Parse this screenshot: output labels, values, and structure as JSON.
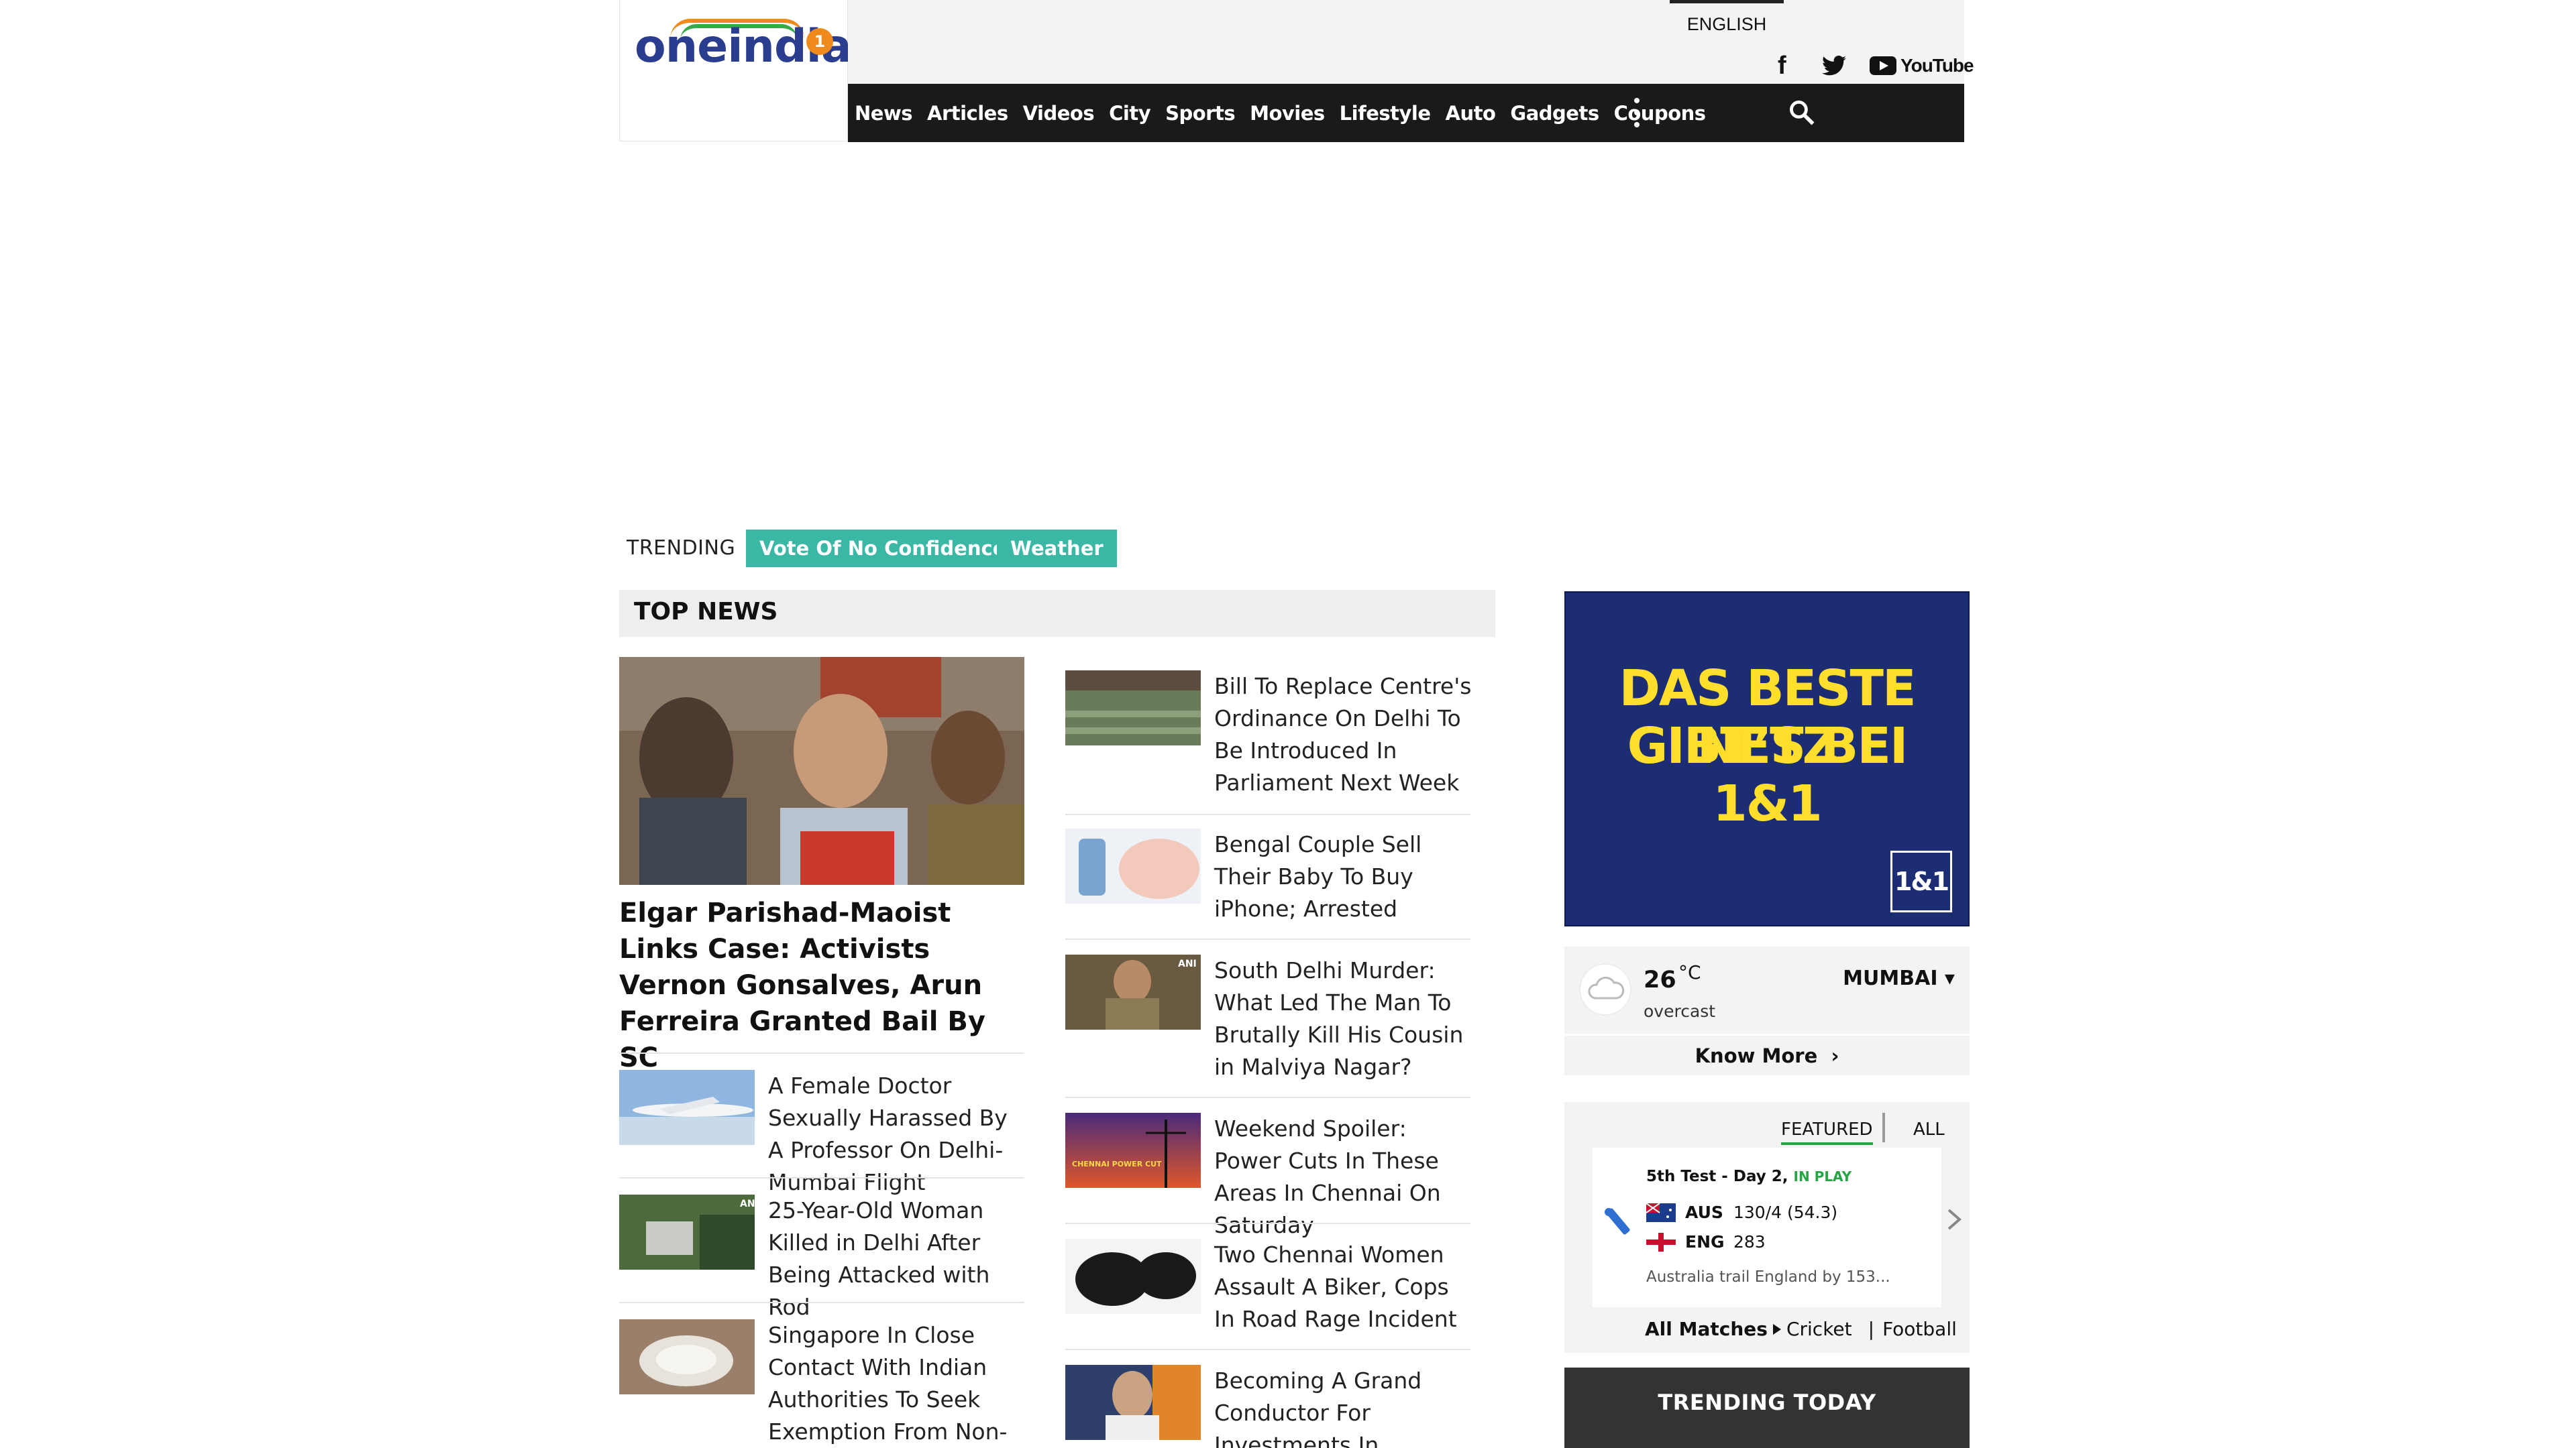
{
  "brand": {
    "logo_text_one": "one",
    "logo_text_india": "india",
    "logo_badge": "1",
    "primary_color": "#2b3d8f",
    "accent_color": "#f08a1c"
  },
  "header": {
    "language": "ENGLISH",
    "social": {
      "facebook_icon": "facebook-icon",
      "twitter_icon": "twitter-icon",
      "youtube_label": "YouTube"
    },
    "nav": [
      "News",
      "Articles",
      "Videos",
      "City",
      "Sports",
      "Movies",
      "Lifestyle",
      "Auto",
      "Gadgets",
      "Coupons"
    ],
    "more_icon": "more-vertical-icon",
    "search_icon": "search-icon"
  },
  "trending": {
    "label": "TRENDING",
    "chips": [
      "Vote Of No Confidence",
      "Weather"
    ],
    "chip_color": "#3bb7a5"
  },
  "top_news": {
    "title": "TOP NEWS",
    "lead": {
      "title": "Elgar Parishad-Maoist Links Case: Activists Vernon Gonsalves, Arun Ferreira Granted Bail By SC"
    },
    "left_stories": [
      "A Female Doctor Sexually Harassed By A Professor On Delhi-Mumbai Flight",
      "25-Year-Old Woman Killed in Delhi After Being Attacked with Rod",
      "Singapore In Close Contact With Indian Authorities To Seek Exemption From Non-"
    ],
    "right_stories": [
      "Bill To Replace Centre's Ordinance On Delhi To Be Introduced In Parliament Next Week",
      "Bengal Couple Sell Their Baby To Buy iPhone; Arrested",
      "South Delhi Murder: What Led The Man To Brutally Kill His Cousin in Malviya Nagar?",
      "Weekend Spoiler: Power Cuts In These Areas In Chennai On Saturday",
      "Two Chennai Women Assault A Biker, Cops In Road Rage Incident",
      "Becoming A Grand Conductor For Investments In"
    ],
    "thumb_tags": {
      "ani": "ANI",
      "chennai_power": "CHENNAI POWER CUT"
    }
  },
  "ad": {
    "line1": "DAS BESTE NETZ",
    "line2": "GIBT’S BEI 1&1",
    "logo": "1&1",
    "bg_color": "#1c2d74",
    "text_color": "#ffde2c"
  },
  "weather": {
    "temperature": "26",
    "unit": "°C",
    "condition": "overcast",
    "city": "MUMBAI ▾",
    "know_more": "Know More",
    "icon": "cloud-icon"
  },
  "scores": {
    "tabs": {
      "featured": "FEATURED",
      "all": "ALL"
    },
    "match_title": "5th Test - Day 2, ",
    "match_status": "IN PLAY",
    "teams": [
      {
        "code": "AUS",
        "score": "130/4 (54.3)",
        "flag": "australia-flag"
      },
      {
        "code": "ENG",
        "score": "283",
        "flag": "england-flag"
      }
    ],
    "summary": "Australia trail England by 153...",
    "all_matches": "All Matches",
    "links": [
      "Cricket",
      "Football"
    ],
    "separator": "|"
  },
  "trending_today": "TRENDING TODAY"
}
